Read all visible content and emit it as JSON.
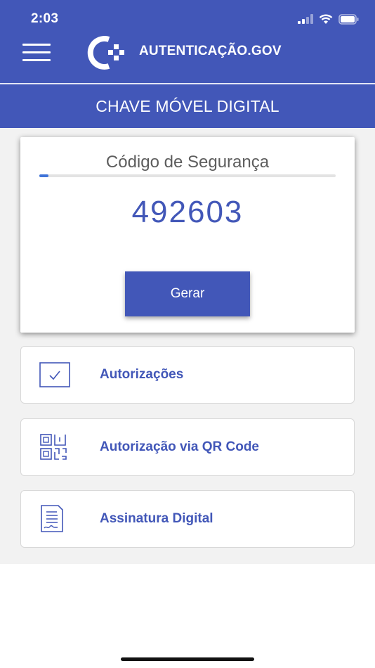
{
  "status_bar": {
    "time": "2:03"
  },
  "app": {
    "name": "AUTENTICAÇÃO.GOV"
  },
  "page_title": "CHAVE MÓVEL DIGITAL",
  "security_code": {
    "label": "Código de Segurança",
    "value": "492603",
    "timer_progress": 0.03,
    "button_label": "Gerar"
  },
  "menu": [
    {
      "label": "Autorizações",
      "icon": "checkbox-icon"
    },
    {
      "label": "Autorização via QR Code",
      "icon": "qr-code-icon"
    },
    {
      "label": "Assinatura Digital",
      "icon": "document-signature-icon"
    }
  ],
  "colors": {
    "primary": "#4257b8",
    "background": "#f2f2f2",
    "progress": "#3f73d8"
  }
}
